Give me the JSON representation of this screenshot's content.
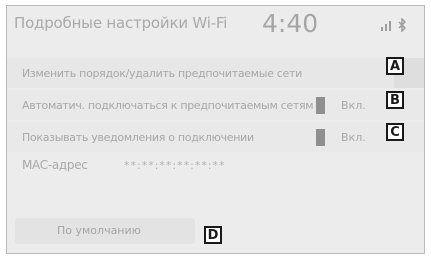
{
  "header": {
    "title": "Подробные настройки Wi-Fi",
    "time": "4:40",
    "status_icons": [
      "signal-icon",
      "bluetooth-icon"
    ]
  },
  "settings": {
    "reorder_label": "Изменить порядок/удалить предпочитаемые сети",
    "auto_connect_label": "Автоматич. подключаться к предпочитаемым сетям",
    "auto_connect_state": "Вкл.",
    "notify_label": "Показывать уведомления о подключении",
    "notify_state": "Вкл.",
    "mac_label": "MAC-адрес",
    "mac_value": "**:**:**:**:**:**"
  },
  "footer": {
    "default_button_label": "По умолчанию"
  },
  "callouts": {
    "a": "A",
    "b": "B",
    "c": "C",
    "d": "D"
  },
  "colors": {
    "screen_bg": "#ececec",
    "text": "#a7a7a7",
    "indicator": "#8f8f8f",
    "callout_border": "#1a1a1a"
  }
}
